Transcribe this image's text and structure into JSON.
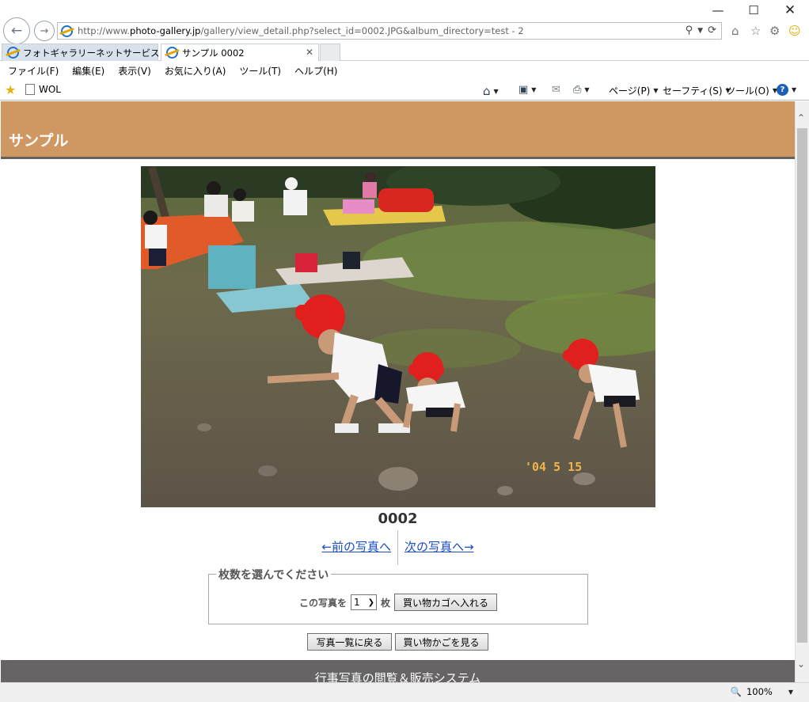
{
  "browser": {
    "address": "http://www.photo-gallery.jp/gallery/view_detail.php?select_id=0002.JPG&album_directory=test - 2",
    "address_host": "photo-gallery.jp",
    "tabs": [
      {
        "label": "フォトギャラリーネットサービス サンプル"
      },
      {
        "label": "サンプル 0002"
      }
    ],
    "menu": [
      "ファイル(F)",
      "編集(E)",
      "表示(V)",
      "お気に入り(A)",
      "ツール(T)",
      "ヘルプ(H)"
    ],
    "favorites": [
      "WOL"
    ],
    "commands": {
      "page": "ページ(P)",
      "safety": "セーフティ(S)",
      "tools": "ツール(O)"
    },
    "zoom": "100%"
  },
  "page": {
    "site_title": "サンプル",
    "photo_id": "0002",
    "photo_date_stamp": "'04 5 15",
    "prev_link": "←前の写真へ",
    "next_link": "次の写真へ→",
    "qty_legend": "枚数を選んでください",
    "qty_prefix": "この写真を",
    "qty_value": "1",
    "qty_suffix": "枚",
    "add_to_cart": "買い物カゴへ入れる",
    "back_to_list": "写真一覧に戻る",
    "view_cart": "買い物かごを見る",
    "footer_text": "行事写真の閲覧＆販売システム"
  }
}
